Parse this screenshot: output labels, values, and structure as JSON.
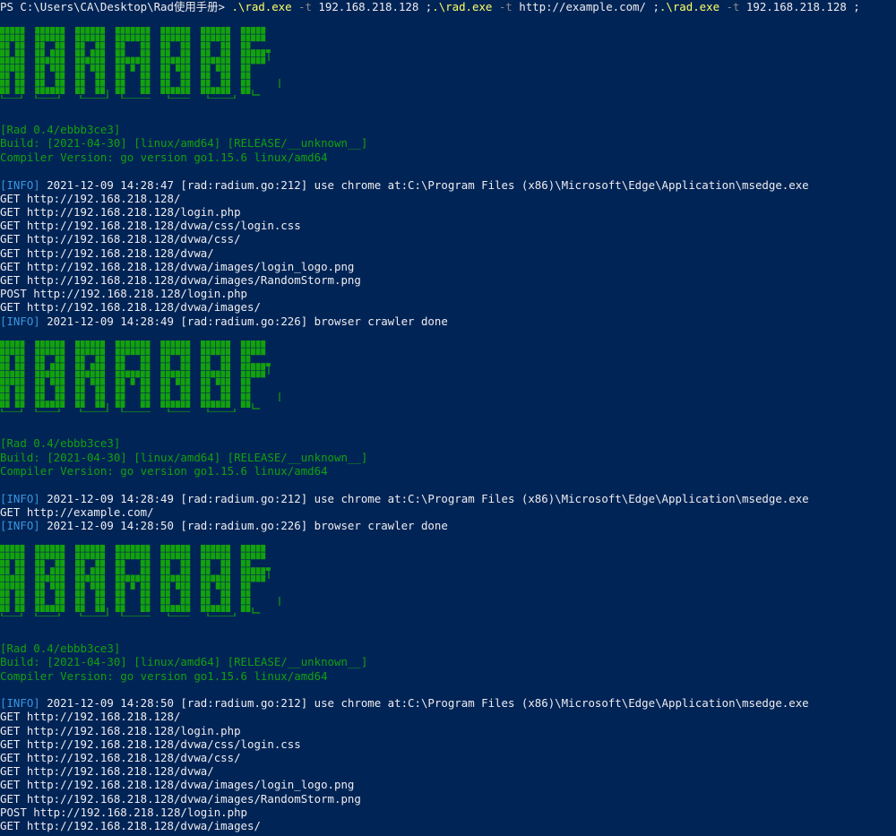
{
  "colors": {
    "background": "#012456",
    "text": "#eeedf0",
    "command": "#ffff66",
    "flag": "#8a8a8a",
    "banner_green": "#13a10e",
    "info_tag": "#3a96dd"
  },
  "prompt": {
    "path": "PS C:\\Users\\CA\\Desktop\\Rad使用手册> ",
    "segments": [
      {
        "cmd": ".\\rad.exe",
        "flag": " -t",
        "arg": " 192.168.218.128",
        "sep": " ;"
      },
      {
        "cmd": ".\\rad.exe",
        "flag": " -t",
        "arg": " http://example.com/",
        "sep": " ;"
      },
      {
        "cmd": ".\\rad.exe",
        "flag": " -t",
        "arg": " 192.168.218.128",
        "sep": " ;"
      }
    ]
  },
  "banner_icon": "rad-ascii-art-logo",
  "runs": [
    {
      "version": "[Rad 0.4/ebbb3ce3]",
      "build": "Build: [2021-04-30] [linux/amd64] [RELEASE/__unknown__]",
      "compiler": "Compiler Version: go version go1.15.6 linux/amd64",
      "start": {
        "tag": "[INFO]",
        "text": " 2021-12-09 14:28:47 [rad:radium.go:212] use chrome at:C:\\Program Files (x86)\\Microsoft\\Edge\\Application\\msedge.exe"
      },
      "requests": [
        "GET http://192.168.218.128/",
        "GET http://192.168.218.128/login.php",
        "GET http://192.168.218.128/dvwa/css/login.css",
        "GET http://192.168.218.128/dvwa/css/",
        "GET http://192.168.218.128/dvwa/",
        "GET http://192.168.218.128/dvwa/images/login_logo.png",
        "GET http://192.168.218.128/dvwa/images/RandomStorm.png",
        "POST http://192.168.218.128/login.php",
        "GET http://192.168.218.128/dvwa/images/"
      ],
      "done": {
        "tag": "[INFO]",
        "text": " 2021-12-09 14:28:49 [rad:radium.go:226] browser crawler done"
      }
    },
    {
      "version": "[Rad 0.4/ebbb3ce3]",
      "build": "Build: [2021-04-30] [linux/amd64] [RELEASE/__unknown__]",
      "compiler": "Compiler Version: go version go1.15.6 linux/amd64",
      "start": {
        "tag": "[INFO]",
        "text": " 2021-12-09 14:28:49 [rad:radium.go:212] use chrome at:C:\\Program Files (x86)\\Microsoft\\Edge\\Application\\msedge.exe"
      },
      "requests": [
        "GET http://example.com/"
      ],
      "done": {
        "tag": "[INFO]",
        "text": " 2021-12-09 14:28:50 [rad:radium.go:226] browser crawler done"
      }
    },
    {
      "version": "[Rad 0.4/ebbb3ce3]",
      "build": "Build: [2021-04-30] [linux/amd64] [RELEASE/__unknown__]",
      "compiler": "Compiler Version: go version go1.15.6 linux/amd64",
      "start": {
        "tag": "[INFO]",
        "text": " 2021-12-09 14:28:50 [rad:radium.go:212] use chrome at:C:\\Program Files (x86)\\Microsoft\\Edge\\Application\\msedge.exe"
      },
      "requests": [
        "GET http://192.168.218.128/",
        "GET http://192.168.218.128/login.php",
        "GET http://192.168.218.128/dvwa/css/login.css",
        "GET http://192.168.218.128/dvwa/css/",
        "GET http://192.168.218.128/dvwa/",
        "GET http://192.168.218.128/dvwa/images/login_logo.png",
        "GET http://192.168.218.128/dvwa/images/RandomStorm.png",
        "POST http://192.168.218.128/login.php",
        "GET http://192.168.218.128/dvwa/images/"
      ],
      "done": null
    }
  ]
}
